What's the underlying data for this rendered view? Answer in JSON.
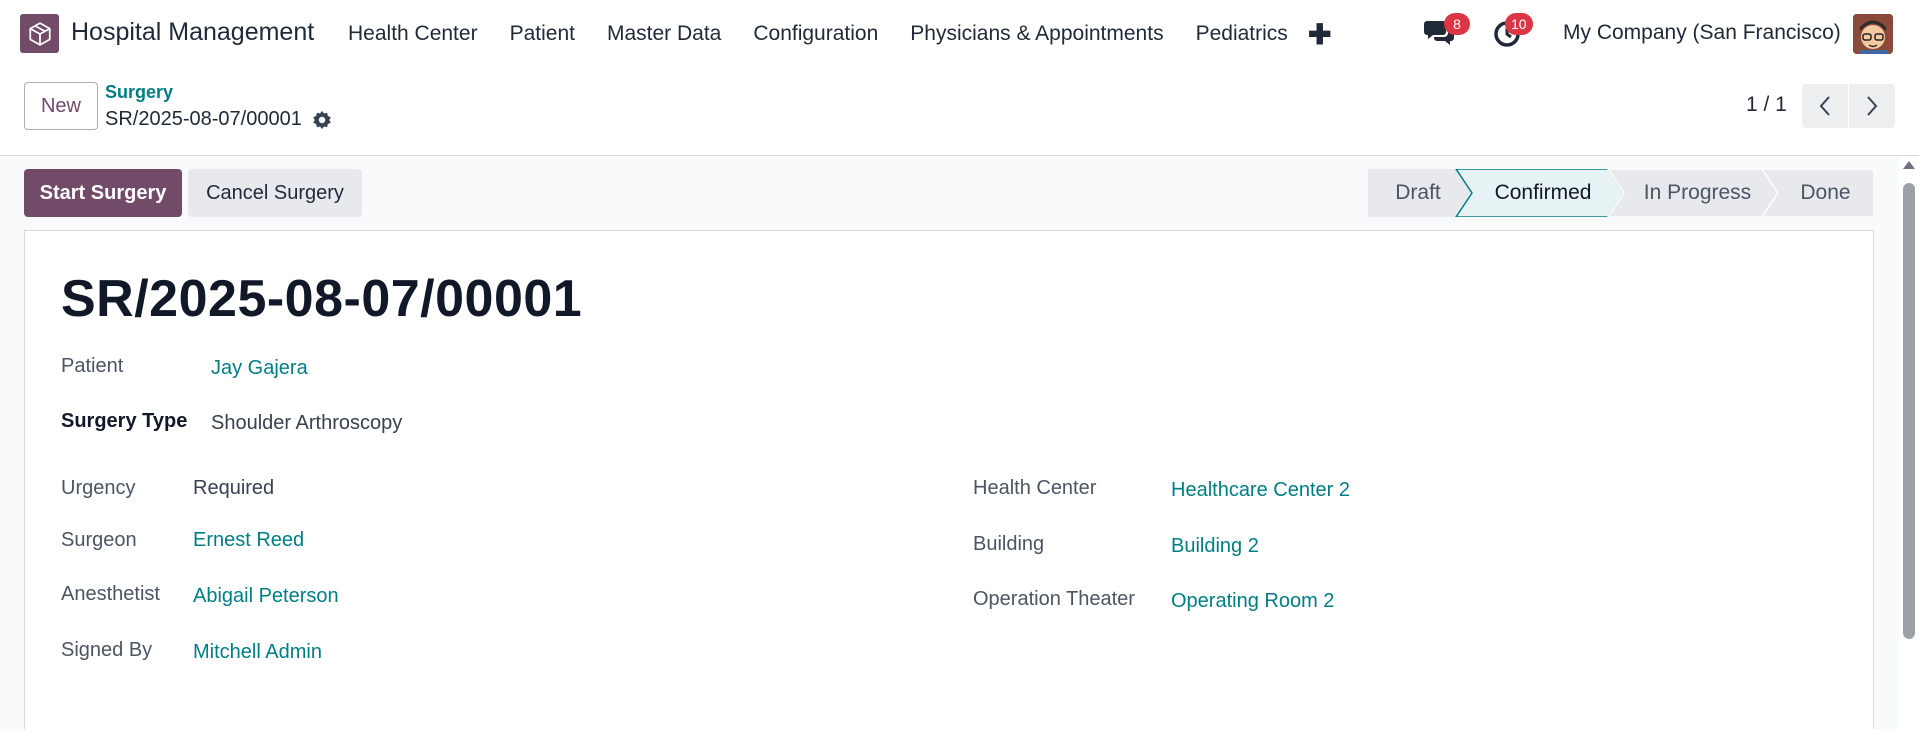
{
  "app": {
    "name": "Hospital Management",
    "logo_icon": "box-icon",
    "brand_color": "#714B67"
  },
  "menu": [
    "Health Center",
    "Patient",
    "Master Data",
    "Configuration",
    "Physicians & Appointments",
    "Pediatrics"
  ],
  "systray": {
    "messages_count": "8",
    "activities_count": "10",
    "company": "My Company (San Francisco)"
  },
  "control": {
    "new_label": "New",
    "breadcrumb": "Surgery",
    "record_name": "SR/2025-08-07/00001",
    "pager": "1 / 1"
  },
  "actions": {
    "start": "Start Surgery",
    "cancel": "Cancel Surgery"
  },
  "stages": [
    {
      "label": "Draft",
      "active": false
    },
    {
      "label": "Confirmed",
      "active": true
    },
    {
      "label": "In Progress",
      "active": false
    },
    {
      "label": "Done",
      "active": false
    }
  ],
  "form": {
    "title": "SR/2025-08-07/00001",
    "patient": {
      "label": "Patient",
      "value": "Jay Gajera"
    },
    "surgery_type": {
      "label": "Surgery Type",
      "value": "Shoulder Arthroscopy"
    },
    "urgency": {
      "label": "Urgency",
      "value": "Required"
    },
    "surgeon": {
      "label": "Surgeon",
      "value": "Ernest Reed"
    },
    "anesthetist": {
      "label": "Anesthetist",
      "value": "Abigail Peterson"
    },
    "signed_by": {
      "label": "Signed By",
      "value": "Mitchell Admin"
    },
    "health_center": {
      "label": "Health Center",
      "value": "Healthcare Center 2"
    },
    "building": {
      "label": "Building",
      "value": "Building 2"
    },
    "operation_theater": {
      "label": "Operation Theater",
      "value": "Operating Room 2"
    }
  },
  "colors": {
    "link": "#017e84",
    "active_stage_border": "#017e84",
    "badge": "#dc3545"
  }
}
